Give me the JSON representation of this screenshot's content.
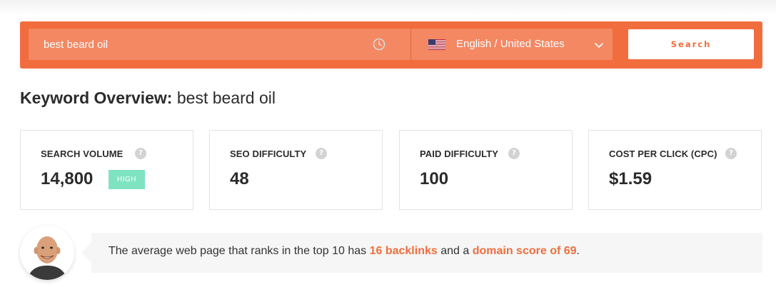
{
  "search": {
    "keyword_value": "best beard oil",
    "history_icon": "clock-icon",
    "language": {
      "flag_icon": "us-flag-icon",
      "label": "English / United States",
      "dropdown_icon": "chevron-down-icon"
    },
    "button_label": "Search"
  },
  "overview": {
    "title_prefix": "Keyword Overview:",
    "keyword": "best beard oil"
  },
  "metrics": [
    {
      "label": "SEARCH VOLUME",
      "value": "14,800",
      "badge": "HIGH",
      "help_icon": "question-icon"
    },
    {
      "label": "SEO DIFFICULTY",
      "value": "48",
      "help_icon": "question-icon"
    },
    {
      "label": "PAID DIFFICULTY",
      "value": "100",
      "help_icon": "question-icon"
    },
    {
      "label": "COST PER CLICK (CPC)",
      "value": "$1.59",
      "help_icon": "question-icon"
    }
  ],
  "tip": {
    "text_before": "The average web page that ranks in the top 10 has",
    "backlinks": "16 backlinks",
    "text_middle": "and a",
    "domain_score": "domain score of 69",
    "text_after": "."
  },
  "colors": {
    "accent": "#f26d3d",
    "field_bg": "#f38863",
    "badge_high": "#7fe3c2"
  }
}
